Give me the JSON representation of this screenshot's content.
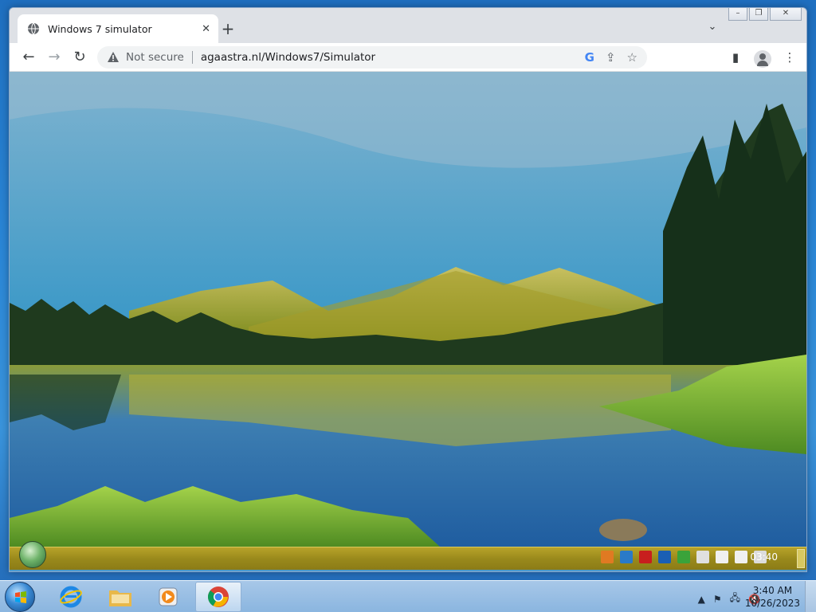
{
  "browser": {
    "tab": {
      "title": "Windows 7 simulator",
      "icon": "globe-icon"
    },
    "new_tab_label": "+",
    "address": {
      "security_label": "Not secure",
      "url": "agaastra.nl/Windows7/Simulator"
    }
  },
  "simulator": {
    "clock": "03:40"
  },
  "taskbar": {
    "clock_time": "3:40 AM",
    "clock_date": "10/26/2023"
  }
}
